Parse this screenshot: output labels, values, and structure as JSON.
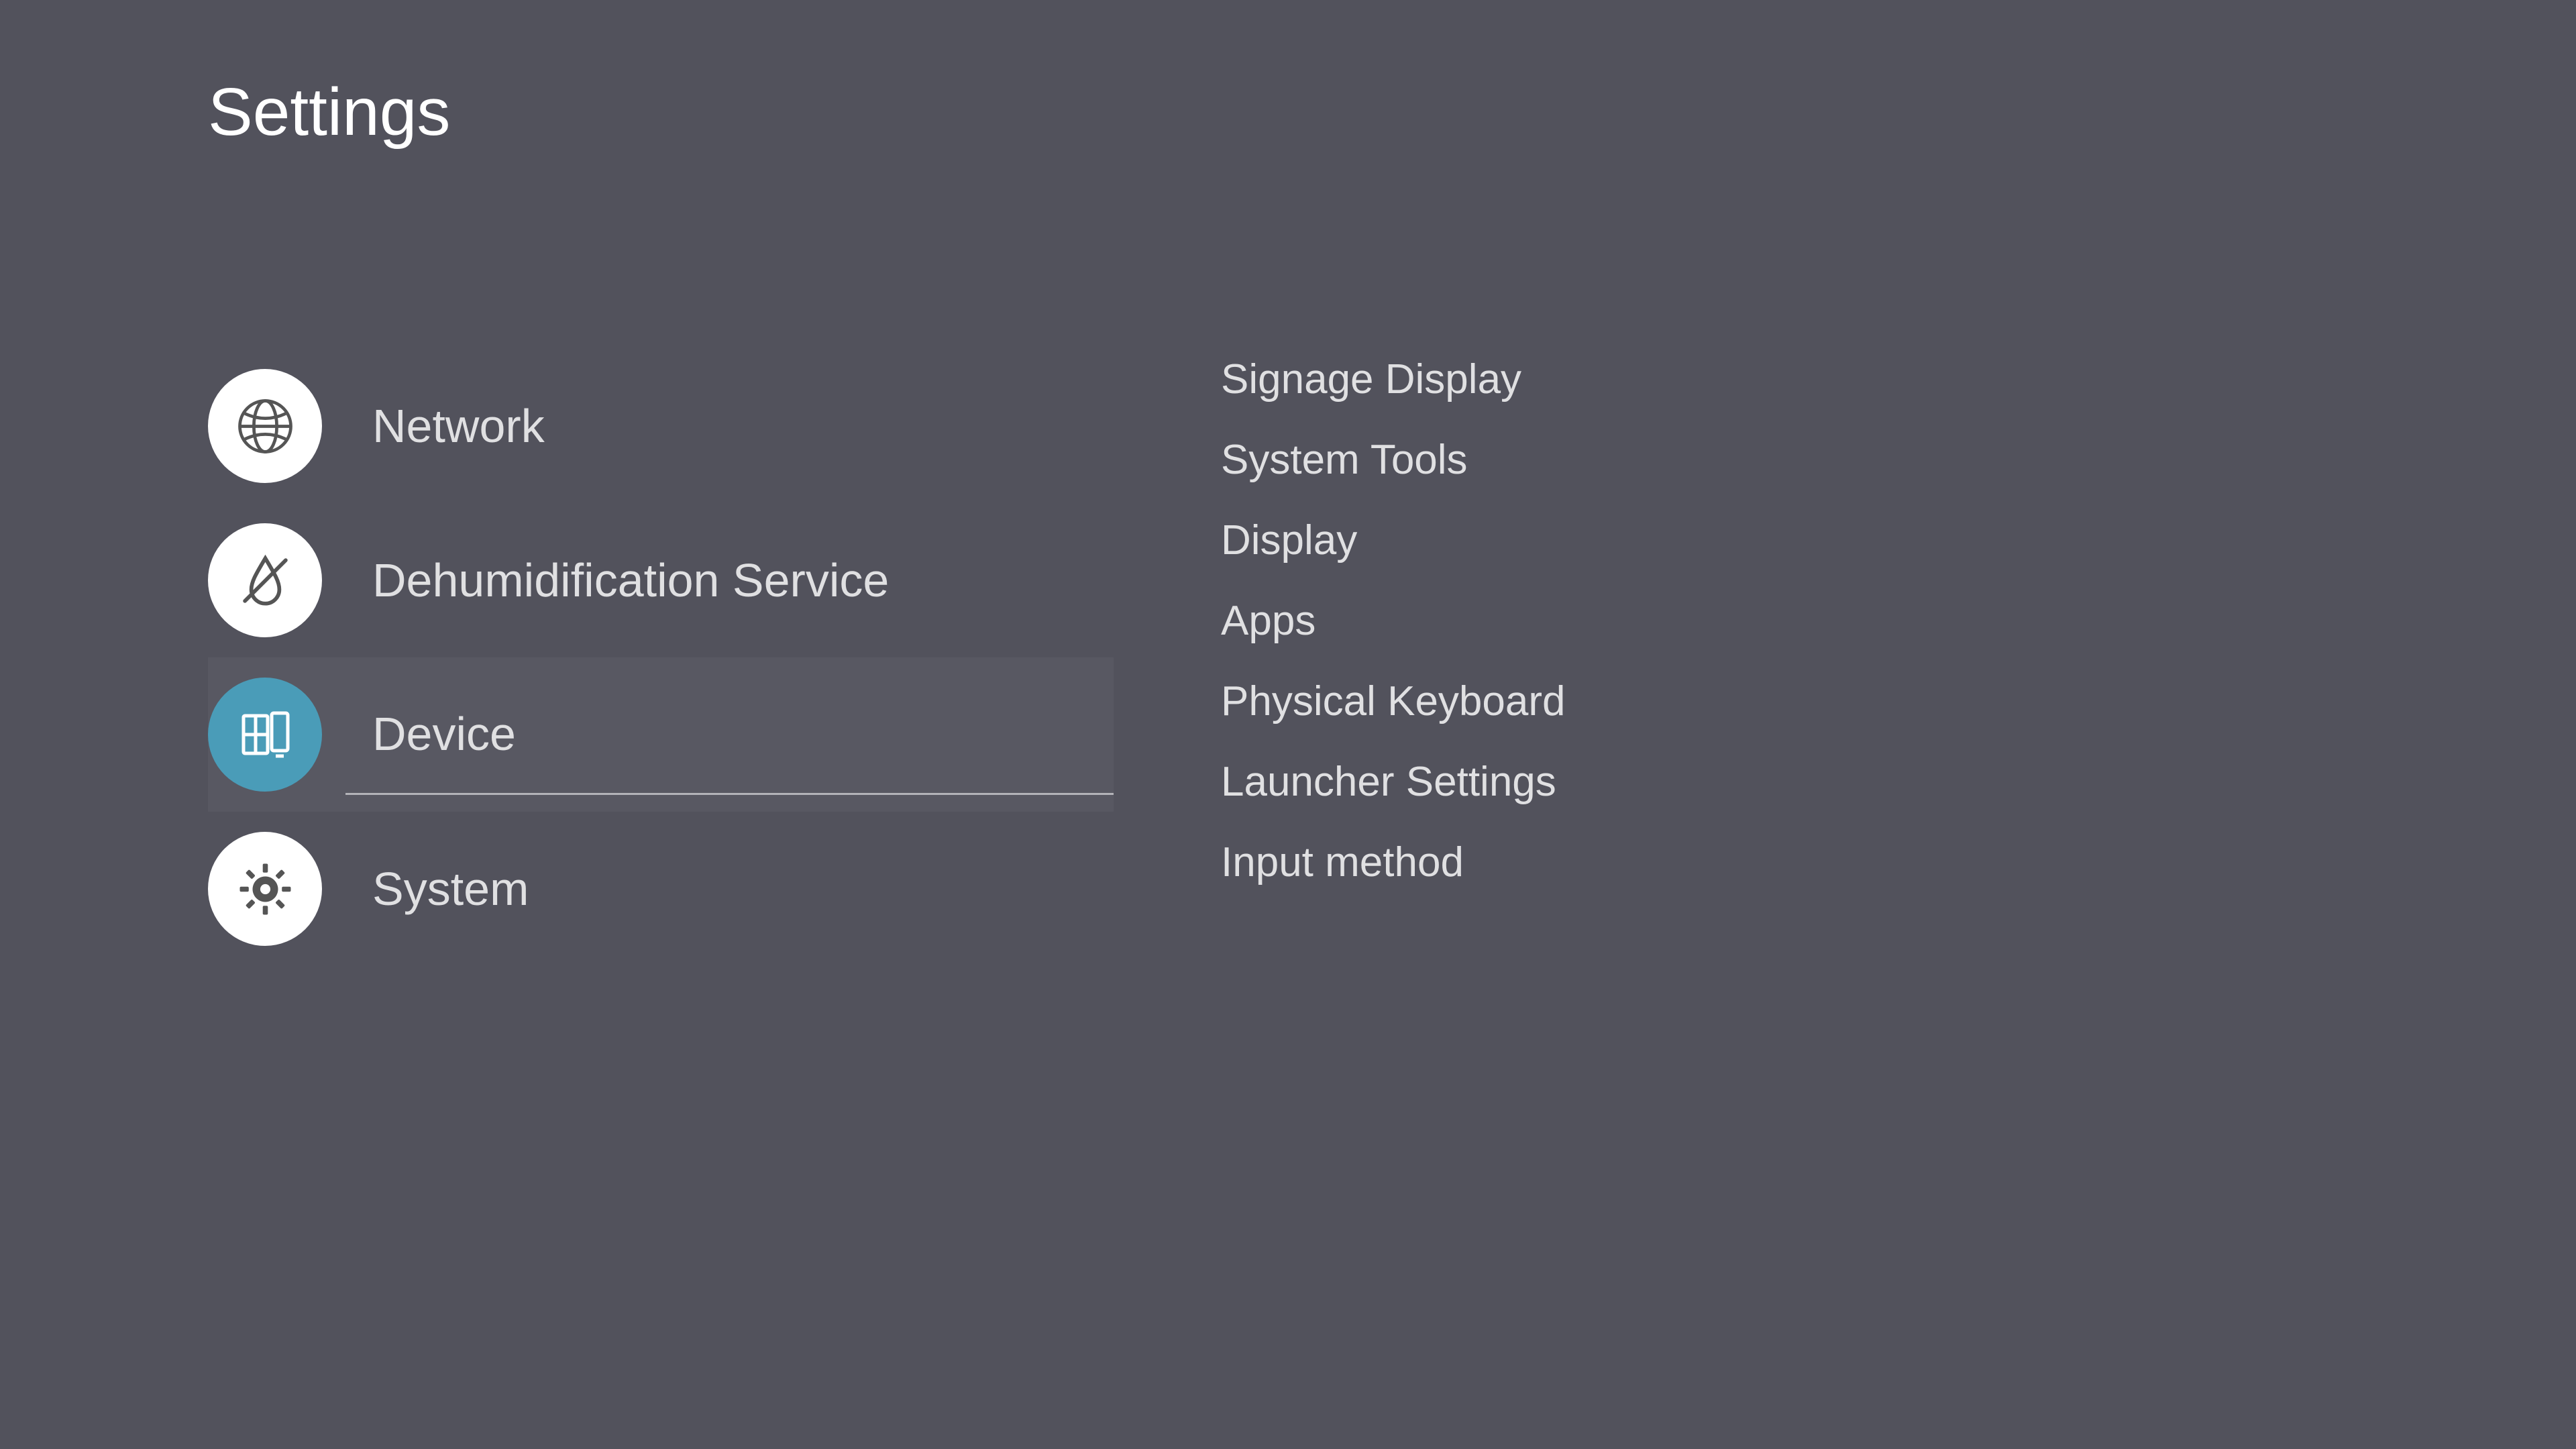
{
  "title": "Settings",
  "sidebar": {
    "items": [
      {
        "label": "Network",
        "icon": "globe-icon",
        "selected": false
      },
      {
        "label": "Dehumidification Service",
        "icon": "dehumidify-icon",
        "selected": false
      },
      {
        "label": "Device",
        "icon": "device-icon",
        "selected": true
      },
      {
        "label": "System",
        "icon": "gear-icon",
        "selected": false
      }
    ]
  },
  "detail": {
    "items": [
      {
        "label": "Signage Display"
      },
      {
        "label": "System Tools"
      },
      {
        "label": "Display"
      },
      {
        "label": "Apps"
      },
      {
        "label": "Physical Keyboard"
      },
      {
        "label": "Launcher Settings"
      },
      {
        "label": "Input method"
      }
    ]
  },
  "colors": {
    "background": "#52525c",
    "accent": "#4a9cb8",
    "iconCircle": "#ffffff",
    "text": "#e0e0e2"
  }
}
